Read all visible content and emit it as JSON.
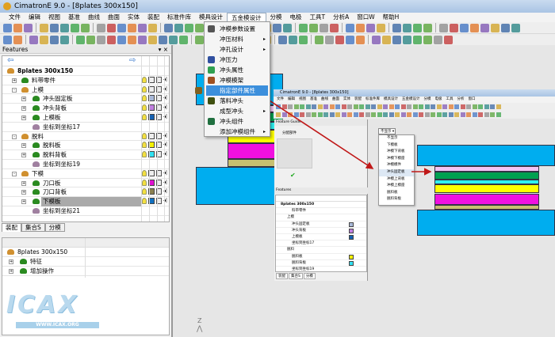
{
  "window": {
    "title": "CimatronE 9.0 - [8plates  300x150]"
  },
  "menubar": [
    "文件",
    "编辑",
    "视图",
    "基准",
    "曲线",
    "曲面",
    "实体",
    "装配",
    "标准件库",
    "模具设计",
    "五金模设计",
    "分模",
    "电极",
    "工具T",
    "分析A",
    "窗口W",
    "帮助H"
  ],
  "menubar_active": 10,
  "features_panel": {
    "title": "Features",
    "pin": "▾ ×",
    "rows": [
      {
        "label": "8plates  300x150",
        "level": 0,
        "icon": "assembly",
        "bold": true,
        "cols": false
      },
      {
        "label": "料带零件",
        "level": 1,
        "icon": "part",
        "exp": "+",
        "cols": true,
        "color": null
      },
      {
        "label": "上模",
        "level": 1,
        "icon": "assembly",
        "exp": "-",
        "cols": true,
        "color": null
      },
      {
        "label": "冲头固定板",
        "level": 2,
        "icon": "part",
        "exp": "+",
        "cols": true,
        "color": "#a8b8d8"
      },
      {
        "label": "冲头背板",
        "level": 2,
        "icon": "part",
        "exp": "+",
        "cols": true,
        "color": "#c07fe0"
      },
      {
        "label": "上模板",
        "level": 2,
        "icon": "part",
        "exp": "+",
        "cols": true,
        "color": "#1560b0"
      },
      {
        "label": "坐标到坐标17",
        "level": 2,
        "icon": "csys",
        "cols": false
      },
      {
        "label": "脱料",
        "level": 1,
        "icon": "assembly",
        "exp": "-",
        "cols": true,
        "color": null
      },
      {
        "label": "脱料板",
        "level": 2,
        "icon": "part",
        "exp": "+",
        "cols": true,
        "color": "#f4f000"
      },
      {
        "label": "脱料背板",
        "level": 2,
        "icon": "part",
        "exp": "+",
        "cols": true,
        "color": "#30e0f0"
      },
      {
        "label": "坐标到坐标19",
        "level": 2,
        "icon": "csys",
        "cols": false
      },
      {
        "label": "下模",
        "level": 1,
        "icon": "assembly",
        "exp": "-",
        "cols": true,
        "color": null
      },
      {
        "label": "刀口板",
        "level": 2,
        "icon": "part",
        "exp": "+",
        "cols": true,
        "color": "#e010d0"
      },
      {
        "label": "刀口背板",
        "level": 2,
        "icon": "part",
        "exp": "+",
        "cols": true,
        "color": "#8a8050"
      },
      {
        "label": "下模板",
        "level": 2,
        "icon": "part",
        "exp": "+",
        "cols": true,
        "color": "#1070c0",
        "selected": true
      },
      {
        "label": "坐标到坐标21",
        "level": 2,
        "icon": "csys",
        "cols": false
      }
    ]
  },
  "tabs": [
    {
      "label": "装配",
      "active": true
    },
    {
      "label": "集合S",
      "active": false
    },
    {
      "label": "分模",
      "active": false
    }
  ],
  "lower_tree": [
    {
      "label": "8plates  300x150",
      "level": 0
    },
    {
      "label": "特征",
      "level": 1
    },
    {
      "label": "增加操作",
      "level": 1
    }
  ],
  "dropdown_menu": [
    {
      "label": "冲模参数设置",
      "icon": "settings",
      "sub": false
    },
    {
      "label": "冲压材料",
      "icon": null,
      "sub": true
    },
    {
      "label": "冲孔设计",
      "icon": null,
      "sub": true
    },
    {
      "label": "冲压力",
      "icon": "force",
      "sub": false
    },
    {
      "label": "冲头属性",
      "icon": "punch",
      "sub": false
    },
    {
      "label": "冲模模架",
      "icon": "moldbase",
      "sub": false
    },
    {
      "label": "指定部件属性",
      "icon": "assign",
      "sub": false,
      "highlighted": true
    },
    {
      "label": "落料冲头",
      "icon": "blank",
      "sub": false
    },
    {
      "label": "成型冲头",
      "icon": null,
      "sub": true
    },
    {
      "label": "冲头组件",
      "icon": "punch-assembly",
      "sub": false
    },
    {
      "label": "添加冲模组件",
      "icon": null,
      "sub": true
    }
  ],
  "inner_screenshot": {
    "title": "CimatronE 9.0 - [8plates  300x150]",
    "menu": [
      "文件",
      "编辑",
      "视图",
      "基准",
      "曲线",
      "曲面",
      "实体",
      "装配",
      "标准件库",
      "模具设计",
      "五金模设计",
      "分模",
      "电极",
      "工具",
      "分析",
      "窗口"
    ],
    "feature_guide": "Feature Guide",
    "guide_item": "分配部件",
    "features_title": "Features",
    "combo": "不显示",
    "options": [
      "不显示",
      "下模板",
      "冲模下背板",
      "冲模下模座",
      "冲模模件",
      "冲头固定板",
      "冲模上背板",
      "冲模上模座",
      "脱料板",
      "脱料背板"
    ],
    "selected_option": 5,
    "tree": [
      "8plates  300x150",
      "料带零件",
      "上模",
      "冲头固定板",
      "冲头背板",
      "上模板",
      "坐标到坐标17",
      "脱料",
      "脱料板",
      "脱料背板",
      "坐标到坐标19"
    ],
    "tree_colors": [
      null,
      null,
      null,
      "#a8b8d8",
      "#c07fe0",
      "#1560b0",
      null,
      null,
      "#f4f000",
      "#30e0f0",
      null
    ],
    "tabs": [
      "装配",
      "集合S",
      "分模"
    ]
  },
  "plate_colors": {
    "blue": "#00adef",
    "pink": "#f4c4f4",
    "green": "#00a050",
    "cyan": "#30f0f0",
    "yellow": "#ffff00",
    "magenta": "#f010e0",
    "olive": "#c8c070"
  },
  "axis_label": "Z",
  "watermark": {
    "text": "ICAX",
    "url": "WWW.ICAX.ORG"
  }
}
